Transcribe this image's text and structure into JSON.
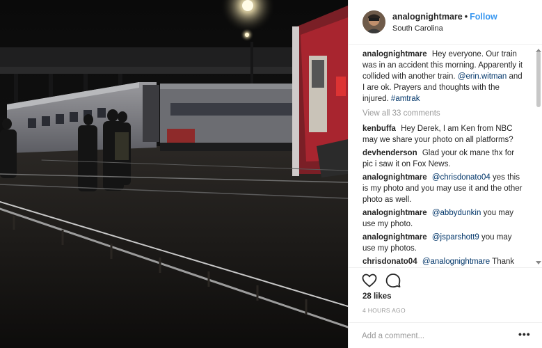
{
  "header": {
    "username": "analognightmare",
    "separator": "•",
    "follow_label": "Follow",
    "location": "South Carolina"
  },
  "caption": {
    "username": "analognightmare",
    "text_before_mention": "Hey everyone. Our train was in an accident this morning. Apparently it collided with another train.",
    "mention": "@erin.witman",
    "text_after_mention": "and I are ok. Prayers and thoughts with the injured.",
    "hashtag": "#amtrak"
  },
  "view_all_comments": "View all 33 comments",
  "comments": [
    {
      "username": "kenbuffa",
      "mention": "",
      "text": "Hey Derek, I am Ken from NBC may we share your photo on all platforms?"
    },
    {
      "username": "devhenderson",
      "mention": "",
      "text": "Glad your ok mane thx for pic i saw it on Fox News."
    },
    {
      "username": "analognightmare",
      "mention": "@chrisdonato04",
      "text": "yes this is my photo and you may use it and the other photo as well."
    },
    {
      "username": "analognightmare",
      "mention": "@abbydunkin",
      "text": "you may use my photo."
    },
    {
      "username": "analognightmare",
      "mention": "@jsparshott9",
      "text": "you may use my photos."
    },
    {
      "username": "chrisdonato04",
      "mention": "@analognightmare",
      "text": "Thank"
    }
  ],
  "actions": {
    "like_icon": "heart-icon",
    "comment_icon": "comment-bubble-icon",
    "likes": "28 likes",
    "time": "4 HOURS AGO"
  },
  "add_comment": {
    "placeholder": "Add a comment...",
    "more_label": "•••"
  },
  "colors": {
    "link": "#003569",
    "follow": "#3897f0",
    "muted": "#999999",
    "train_red": "#c0212c"
  }
}
